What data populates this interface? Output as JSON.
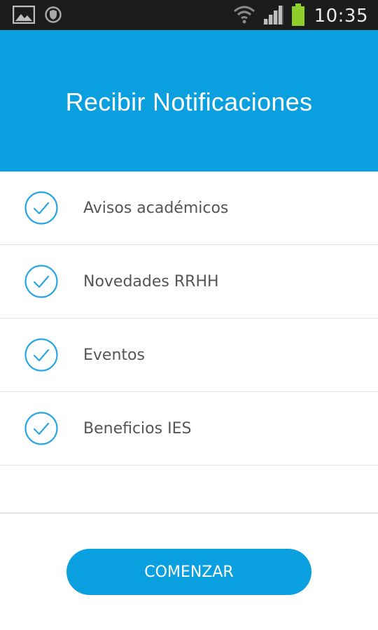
{
  "status_bar": {
    "time": "10:35",
    "icons": [
      "image-icon",
      "shield-icon",
      "wifi-icon",
      "signal-icon",
      "battery-icon"
    ]
  },
  "header": {
    "title": "Recibir Notificaciones",
    "background": "#0a9fdf"
  },
  "notifications": {
    "items": [
      {
        "label": "Avisos académicos",
        "checked": true
      },
      {
        "label": "Novedades RRHH",
        "checked": true
      },
      {
        "label": "Eventos",
        "checked": true
      },
      {
        "label": "Beneficios IES",
        "checked": true
      }
    ],
    "check_color": "#2aa6e2"
  },
  "start_button": {
    "label": "COMENZAR",
    "color": "#0a9fdf"
  }
}
